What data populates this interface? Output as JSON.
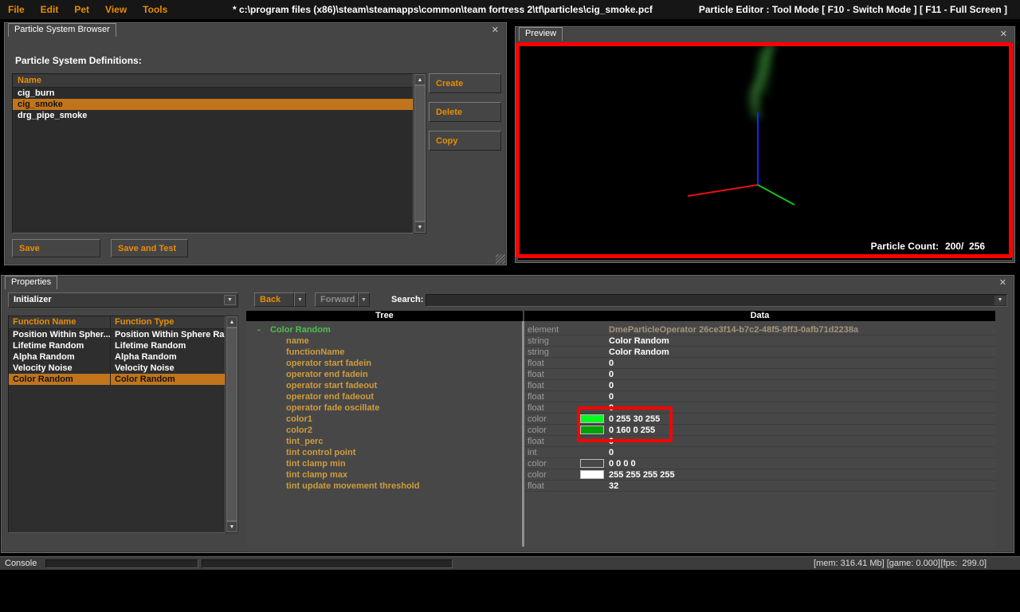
{
  "colors": {
    "selection": "#c0741c",
    "menu_accent": "#e88d00",
    "tree_root": "#4fbf4f",
    "tree_child": "#d09c3c",
    "annotation": "#fb0200"
  },
  "menubar": {
    "items": [
      "File",
      "Edit",
      "Pet",
      "View",
      "Tools"
    ],
    "title": "* c:\\program files (x86)\\steam\\steamapps\\common\\team fortress 2\\tf\\particles\\cig_smoke.pcf",
    "mode_info": "Particle Editor : Tool Mode [ F10 - Switch Mode ] [ F11 - Full Screen ]"
  },
  "browser": {
    "tab": "Particle System Browser",
    "definitions_label": "Particle System Definitions:",
    "list_header": "Name",
    "items": [
      "cig_burn",
      "cig_smoke",
      "drg_pipe_smoke"
    ],
    "selected_item": "cig_smoke",
    "create": "Create",
    "delete": "Delete",
    "copy": "Copy",
    "save": "Save",
    "save_and_test": "Save and Test"
  },
  "preview": {
    "tab": "Preview",
    "particle_count_label": "Particle Count:",
    "particle_count_value": "200/  256"
  },
  "properties": {
    "tab": "Properties",
    "filter_dropdown": "Initializer",
    "function_table": {
      "headers": [
        "Function Name",
        "Function Type"
      ],
      "rows": [
        {
          "name": "Position Within Spher...",
          "type": "Position Within Sphere Ra."
        },
        {
          "name": "Lifetime Random",
          "type": "Lifetime Random"
        },
        {
          "name": "Alpha Random",
          "type": "Alpha Random"
        },
        {
          "name": "Velocity Noise",
          "type": "Velocity Noise"
        },
        {
          "name": "Color Random",
          "type": "Color Random"
        }
      ],
      "selected_row": "Color Random"
    },
    "back": "Back",
    "forward": "Forward",
    "search_label": "Search:",
    "search_value": "",
    "tree_header": "Tree",
    "data_header": "Data",
    "tree_root": "Color Random",
    "tree_children": [
      "name",
      "functionName",
      "operator start fadein",
      "operator end fadein",
      "operator start fadeout",
      "operator end fadeout",
      "operator fade oscillate",
      "color1",
      "color2",
      "tint_perc",
      "tint control point",
      "tint clamp min",
      "tint clamp max",
      "tint update movement threshold"
    ],
    "data_rows": [
      {
        "type": "element",
        "value": "DmeParticleOperator 26ce3f14-b7c2-48f5-9ff3-0afb71d2238a"
      },
      {
        "type": "string",
        "value": "Color Random"
      },
      {
        "type": "string",
        "value": "Color Random"
      },
      {
        "type": "float",
        "value": "0"
      },
      {
        "type": "float",
        "value": "0"
      },
      {
        "type": "float",
        "value": "0"
      },
      {
        "type": "float",
        "value": "0"
      },
      {
        "type": "float",
        "value": "0"
      },
      {
        "type": "color",
        "value": "0 255 30 255",
        "swatch": "#00ff1e"
      },
      {
        "type": "color",
        "value": "0 160 0 255",
        "swatch": "#00a000"
      },
      {
        "type": "float",
        "value": "0"
      },
      {
        "type": "int",
        "value": "0"
      },
      {
        "type": "color",
        "value": "0 0 0 0",
        "swatch": "#00000000"
      },
      {
        "type": "color",
        "value": "255 255 255 255",
        "swatch": "#ffffff"
      },
      {
        "type": "float",
        "value": "32"
      }
    ]
  },
  "console": {
    "label": "Console",
    "mem_game": "[mem: 316.41 Mb] [game: 0.000]",
    "fps": "[fps:  299.0]"
  }
}
